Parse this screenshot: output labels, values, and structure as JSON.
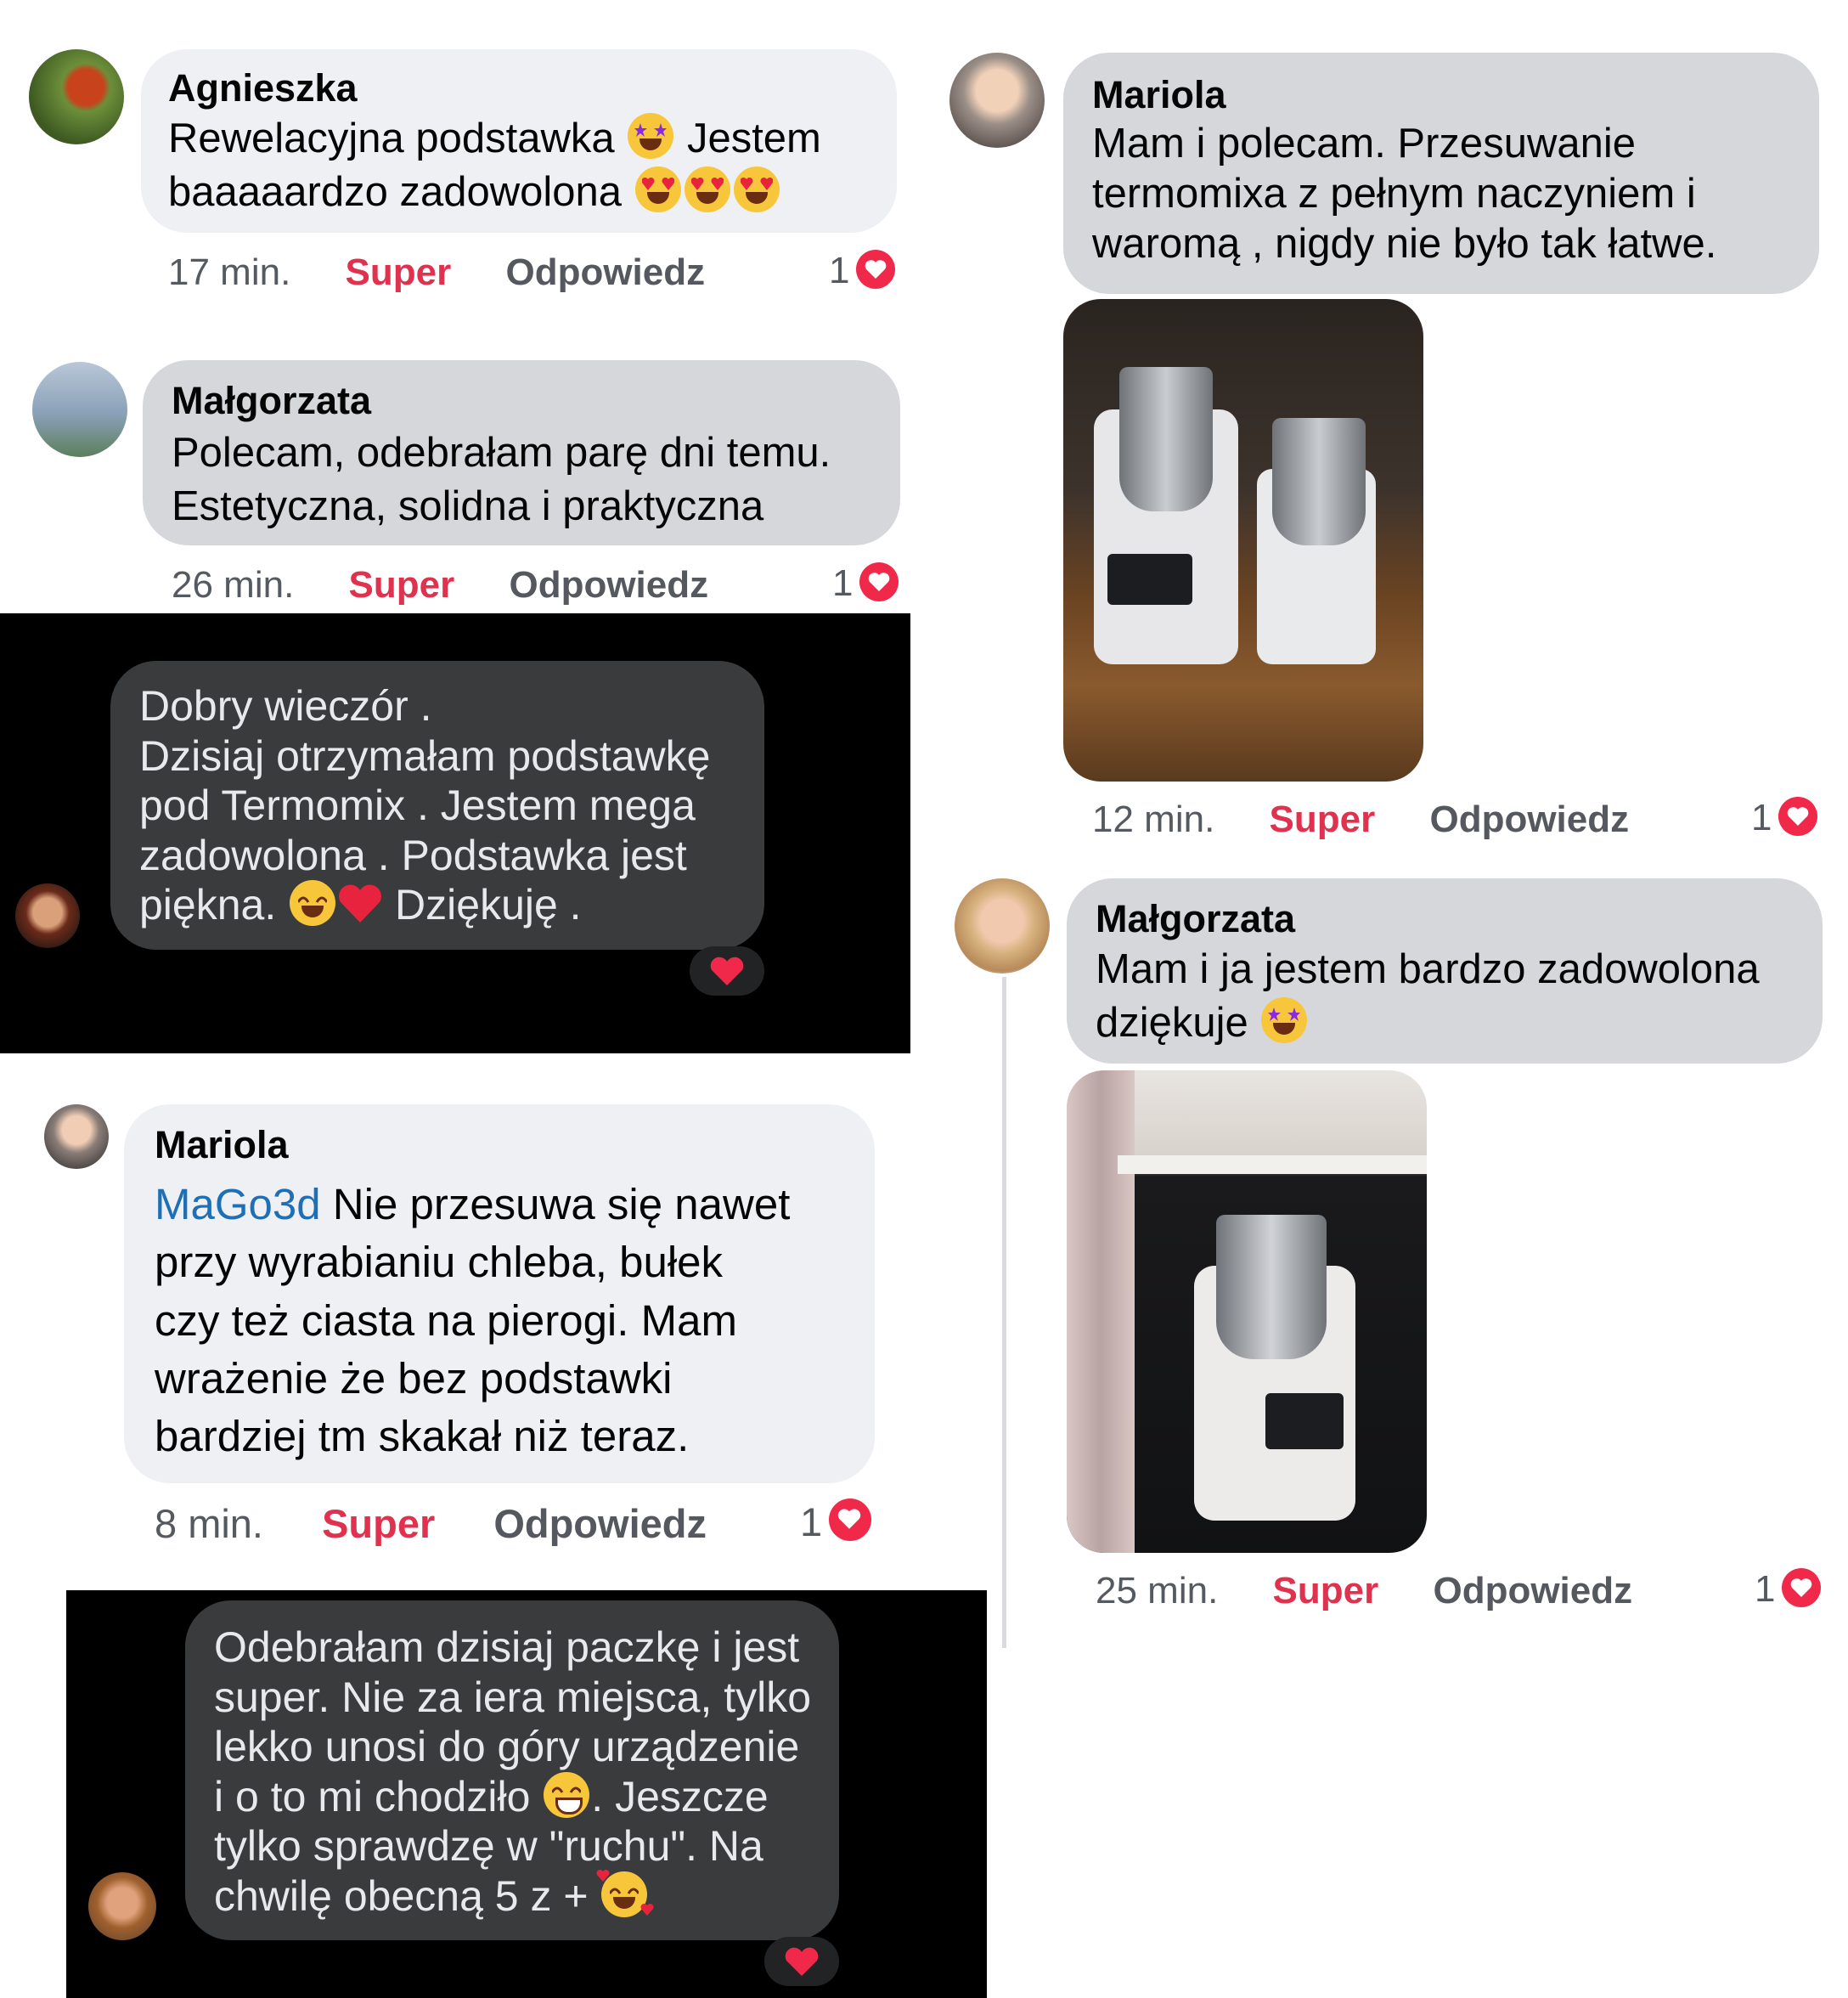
{
  "comments": [
    {
      "author": "Agnieszka",
      "line1": "Rewelacyjna podstawka",
      "line1b": "Jestem",
      "line2": "baaaaardzo zadowolona",
      "time": "17 min.",
      "like": "Super",
      "reply": "Odpowiedz",
      "count": "1",
      "emojis": [
        "star-struck-icon",
        "heart-eyes-icon"
      ]
    },
    {
      "author": "Małgorzata",
      "line1": "Polecam, odebrałam parę dni temu.",
      "line2": "Estetyczna, solidna i praktyczna",
      "time": "26 min.",
      "like": "Super",
      "reply": "Odpowiedz",
      "count": "1"
    },
    {
      "lines": [
        "Dobry wieczór .",
        "Dzisiaj otrzymałam podstawkę",
        "pod Termomix . Jestem mega",
        "zadowolona . Podstawka jest"
      ],
      "last_before": "piękna.",
      "last_after": "Dziękuję ."
    },
    {
      "author": "Mariola",
      "mention": "MaGo3d",
      "line1": " Nie przesuwa się nawet",
      "lines": [
        "przy wyrabianiu chleba, bułek",
        "czy też ciasta na pierogi. Mam",
        "wrażenie że bez podstawki",
        "bardziej tm skakał niż teraz."
      ],
      "time": "8 min.",
      "like": "Super",
      "reply": "Odpowiedz",
      "count": "1"
    },
    {
      "lines": [
        "Odebrałam dzisiaj paczkę i jest",
        "super. Nie za iera miejsca, tylko",
        "lekko unosi do góry urządzenie"
      ],
      "line4_before": "i o to mi chodziło",
      "line4_after": ". Jeszcze",
      "line5": "tylko sprawdzę w \"ruchu\". Na",
      "line6": "chwilę obecną 5 z +"
    },
    {
      "author": "Mariola",
      "lines": [
        "Mam i polecam. Przesuwanie",
        "termomixa z pełnym naczyniem i",
        "waromą , nigdy nie było tak łatwe."
      ],
      "time": "12 min.",
      "like": "Super",
      "reply": "Odpowiedz",
      "count": "1"
    },
    {
      "author": "Małgorzata",
      "line1": "Mam i ja jestem bardzo zadowolona",
      "line2": "dziękuje",
      "time": "25 min.",
      "like": "Super",
      "reply": "Odpowiedz",
      "count": "1"
    }
  ],
  "colors": {
    "like": "#e0314e",
    "mention": "#1f6fb4",
    "heart": "#f0284a",
    "dark_panel": "#000000",
    "dark_bubble": "#3a3b3c"
  }
}
